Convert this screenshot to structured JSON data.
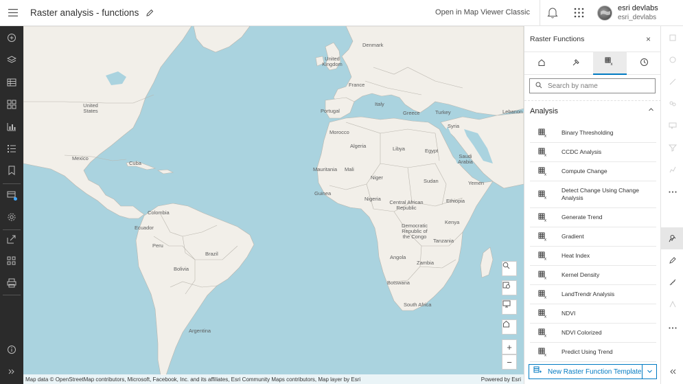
{
  "header": {
    "title": "Raster analysis - functions",
    "open_classic": "Open in Map Viewer Classic",
    "user_name": "esri devlabs",
    "user_handle": "esri_devlabs"
  },
  "left_toolbar": {
    "items": [
      "add-icon",
      "layers-icon",
      "table-icon",
      "basemap-icon",
      "charts-icon",
      "legend-icon",
      "bookmarks-icon",
      "raster-analysis-icon",
      "settings-icon",
      "share-icon",
      "tiles-icon",
      "print-icon",
      "info-icon",
      "expand-icon"
    ]
  },
  "map": {
    "labels": [
      {
        "name": "Denmark"
      },
      {
        "name": "United Kingdom"
      },
      {
        "name": "France"
      },
      {
        "name": "Portugal"
      },
      {
        "name": "Italy"
      },
      {
        "name": "Greece"
      },
      {
        "name": "Turkey"
      },
      {
        "name": "Lebanon"
      },
      {
        "name": "Syria"
      },
      {
        "name": "Morocco"
      },
      {
        "name": "Algeria"
      },
      {
        "name": "Libya"
      },
      {
        "name": "Egypt"
      },
      {
        "name": "Saudi Arabia"
      },
      {
        "name": "Mauritania"
      },
      {
        "name": "Mali"
      },
      {
        "name": "Niger"
      },
      {
        "name": "Sudan"
      },
      {
        "name": "Yemen"
      },
      {
        "name": "Guinea"
      },
      {
        "name": "Nigeria"
      },
      {
        "name": "Ethiopia"
      },
      {
        "name": "Central African Republic"
      },
      {
        "name": "Democratic Republic of the Congo"
      },
      {
        "name": "Kenya"
      },
      {
        "name": "Tanzania"
      },
      {
        "name": "Angola"
      },
      {
        "name": "Zambia"
      },
      {
        "name": "Botswana"
      },
      {
        "name": "South Africa"
      },
      {
        "name": "United States"
      },
      {
        "name": "Mexico"
      },
      {
        "name": "Cuba"
      },
      {
        "name": "Colombia"
      },
      {
        "name": "Ecuador"
      },
      {
        "name": "Peru"
      },
      {
        "name": "Brazil"
      },
      {
        "name": "Bolivia"
      },
      {
        "name": "Argentina"
      }
    ],
    "attribution": "Map data © OpenStreetMap contributors, Microsoft, Facebook, Inc. and its affiliates, Esri Community Maps contributors, Map layer by Esri",
    "powered_by": "Powered by Esri",
    "controls": [
      "search-icon",
      "screenshot-icon",
      "display-icon",
      "home-icon",
      "zoom-in-icon",
      "zoom-out-icon"
    ],
    "zoom_in": "+",
    "zoom_out": "−"
  },
  "panel": {
    "title": "Raster Functions",
    "close": "×",
    "tabs": [
      "home-icon",
      "tools-icon",
      "raster-function-icon",
      "history-icon"
    ],
    "active_tab": 2,
    "search_placeholder": "Search by name",
    "group_title": "Analysis",
    "functions": [
      "Binary Thresholding",
      "CCDC Analysis",
      "Compute Change",
      "Detect Change Using Change Analysis",
      "Generate Trend",
      "Gradient",
      "Heat Index",
      "Kernel Density",
      "LandTrendr Analysis",
      "NDVI",
      "NDVI Colorized",
      "Predict Using Trend"
    ],
    "new_template": "New Raster Function Template"
  },
  "colors": {
    "accent": "#007ac2",
    "water": "#aad3df",
    "land": "#f2efe9",
    "dark_toolbar": "#2b2b2b"
  }
}
